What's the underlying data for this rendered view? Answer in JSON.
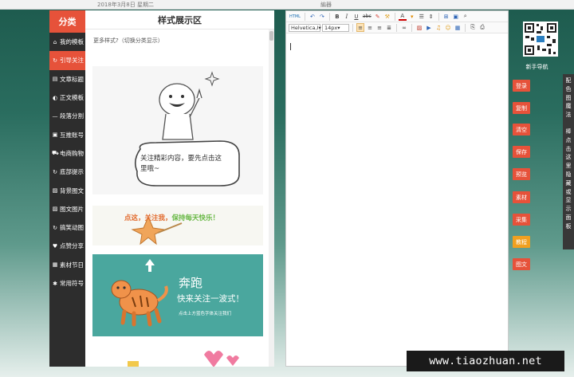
{
  "top": {
    "date": "2018年3月8日 星期二",
    "editor_label": "編器"
  },
  "sidebar": {
    "title": "分类",
    "items": [
      {
        "icon": "home-icon",
        "glyph": "⌂",
        "label": "我的模板"
      },
      {
        "icon": "refresh-icon",
        "glyph": "↻",
        "label": "引导关注"
      },
      {
        "icon": "document-icon",
        "glyph": "▤",
        "label": "文章标题"
      },
      {
        "icon": "circle-half-icon",
        "glyph": "◐",
        "label": "正文模板"
      },
      {
        "icon": "minus-icon",
        "glyph": "—",
        "label": "段落分割"
      },
      {
        "icon": "image-icon",
        "glyph": "▣",
        "label": "互推账号"
      },
      {
        "icon": "cart-icon",
        "glyph": "⛟",
        "label": "电商购物"
      },
      {
        "icon": "refresh-icon",
        "glyph": "↻",
        "label": "底部提示"
      },
      {
        "icon": "picture-icon",
        "glyph": "▨",
        "label": "背景图文"
      },
      {
        "icon": "picture-icon",
        "glyph": "▨",
        "label": "图文图片"
      },
      {
        "icon": "refresh-icon",
        "glyph": "↻",
        "label": "搞笑动图"
      },
      {
        "icon": "thumbs-up-icon",
        "glyph": "♥",
        "label": "点赞分享"
      },
      {
        "icon": "calendar-icon",
        "glyph": "▦",
        "label": "素材节日"
      },
      {
        "icon": "share-icon",
        "glyph": "✱",
        "label": "常用符号"
      }
    ],
    "active_index": 1
  },
  "styles": {
    "title": "样式展示区",
    "hint": "更多样式?（切换分类显示）",
    "card1_text": "关注精彩内容，要先点击这里哦~",
    "card2_text_a": "点这，",
    "card2_text_b": "关注我，",
    "card2_text_c": "保持每天快乐！",
    "card3_title": "奔跑",
    "card3_sub": "快来关注一波式！",
    "card3_small": "点击上方蓝色字体关注我们"
  },
  "editor": {
    "font_family": "Helvetica,I",
    "font_size": "14px",
    "buttons": {
      "html": "HTML",
      "undo": "↶",
      "redo": "↷",
      "bold": "B",
      "italic": "I",
      "underline": "U",
      "strike": "abc",
      "brush": "✎",
      "tint": "A"
    }
  },
  "right": {
    "newbie": "新手导航",
    "buttons": [
      {
        "label": "登录",
        "color": "#e6523a"
      },
      {
        "label": "复制",
        "color": "#e6523a"
      },
      {
        "label": "清空",
        "color": "#e6523a"
      },
      {
        "label": "保存",
        "color": "#e6523a"
      },
      {
        "label": "预览",
        "color": "#e6523a"
      },
      {
        "label": "素材",
        "color": "#e6523a"
      },
      {
        "label": "采集",
        "color": "#e6523a"
      },
      {
        "label": "教程",
        "color": "#f0a020"
      },
      {
        "label": "图文",
        "color": "#e6523a"
      }
    ],
    "vertical_text": "配色图魔法棒点击这里隐藏或显示面板"
  },
  "watermark": "www.tiaozhuan.net",
  "colors": {
    "accent": "#e6523a",
    "sidebar_bg": "#2d2d2d",
    "teal": "#4aa79e"
  }
}
